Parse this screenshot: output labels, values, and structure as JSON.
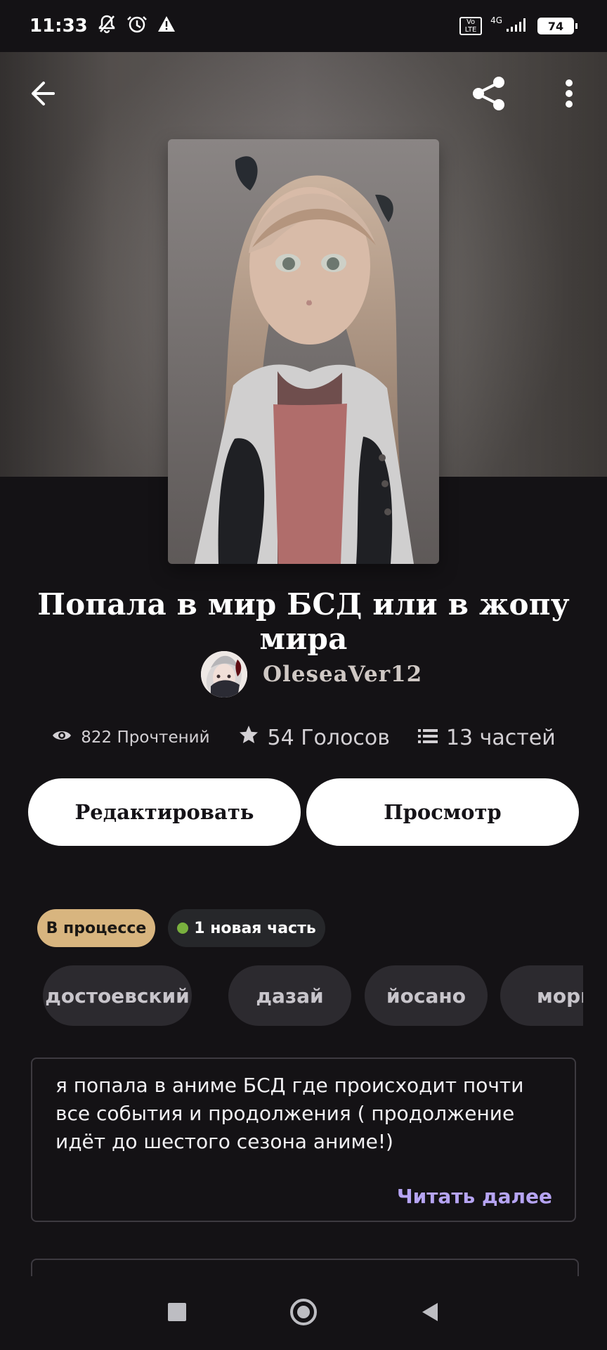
{
  "status_bar": {
    "time": "11:33",
    "network": "4G",
    "battery": "74",
    "volte": "Vo LTE"
  },
  "header": {
    "back_icon": "arrow-left-icon",
    "share_icon": "share-icon",
    "more_icon": "more-vertical-icon"
  },
  "story": {
    "title": "Попала в мир БСД или в жопу мира",
    "author": "OleseaVer12",
    "reads": "822 Прочтений",
    "votes": "54 Голосов",
    "parts": "13 частей"
  },
  "actions": {
    "edit_label": "Редактировать",
    "preview_label": "Просмотр"
  },
  "status": {
    "in_progress": "В процессе",
    "new_part": "1 новая часть"
  },
  "tags": [
    "достоевский",
    "дазай",
    "йосано",
    "мори"
  ],
  "description": {
    "text": "я попала в аниме БСД где происходит почти все события и продолжения ( продолжение идёт до шестого сезона аниме!)",
    "read_more": "Читать далее"
  },
  "colors": {
    "background": "#141215",
    "accent_read_more": "#b6a4f3",
    "in_progress_pill": "#d8b57f",
    "new_dot": "#79b03e"
  }
}
